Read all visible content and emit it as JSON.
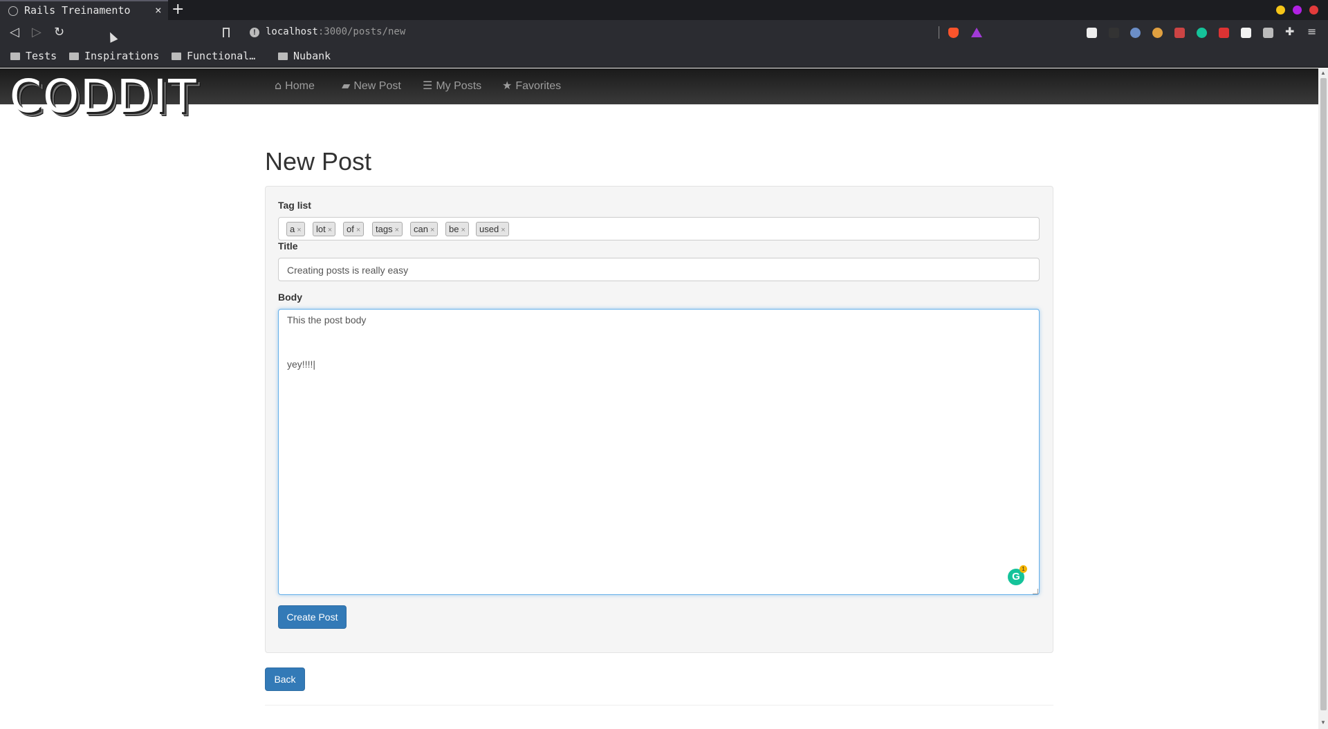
{
  "browser": {
    "tab_title": "Rails Treinamento",
    "tab_close": "×",
    "new_tab": "+",
    "url_host": "localhost",
    "url_rest": ":3000/posts/new",
    "bookmarks": [
      "Tests",
      "Inspirations",
      "Functional…",
      "Nubank"
    ],
    "window_dot_colors": [
      "#f5c518",
      "#b121e3",
      "#e23b3b"
    ]
  },
  "app": {
    "logo": "CODDIT",
    "nav": [
      {
        "icon": "home-icon",
        "label": "Home"
      },
      {
        "icon": "book-icon",
        "label": "New Post"
      },
      {
        "icon": "list-icon",
        "label": "My Posts"
      },
      {
        "icon": "star-icon",
        "label": "Favorites"
      }
    ]
  },
  "form": {
    "heading": "New Post",
    "tag_list_label": "Tag list",
    "tags": [
      "a",
      "lot",
      "of",
      "tags",
      "can",
      "be",
      "used"
    ],
    "tag_remove": "×",
    "title_label": "Title",
    "title_value": "Creating posts is really easy",
    "body_label": "Body",
    "body_lines": [
      "This the post body",
      "",
      "",
      "",
      "yey!!!!|"
    ],
    "grammarly_letter": "G",
    "grammarly_count": "1",
    "submit_label": "Create Post",
    "back_label": "Back"
  },
  "colors": {
    "primary_button": "#337ab7",
    "focus_border": "#66afe9"
  }
}
